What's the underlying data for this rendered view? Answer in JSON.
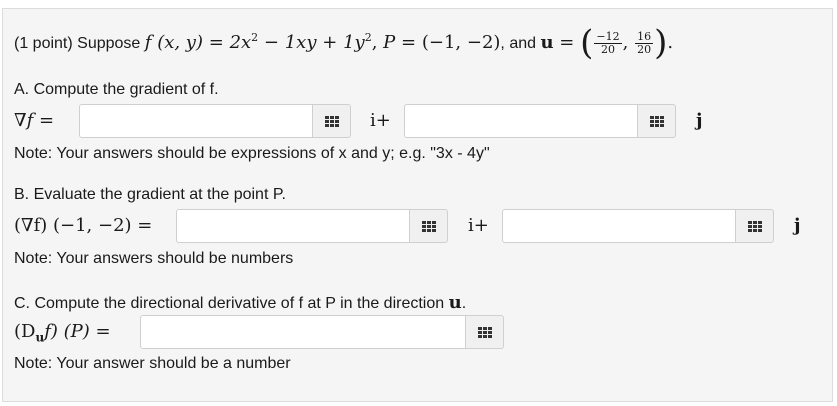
{
  "problem": {
    "points": "(1 point)",
    "intro": "Suppose",
    "function_name": "f",
    "function_args": "(x, y)",
    "equals": "=",
    "term1": "2x",
    "term1_exp": "2",
    "minus": "−",
    "term2": "1xy",
    "plus": "+",
    "term3": "1y",
    "term3_exp": "2",
    "comma": ",",
    "point_label": "P",
    "point_value": "(−1, −2)",
    "and": ", and",
    "vector_label": "u",
    "frac1_num": "−12",
    "frac1_den": "20",
    "frac2_num": "16",
    "frac2_den": "20",
    "period": "."
  },
  "part_a": {
    "prompt": "A. Compute the gradient of f.",
    "lhs": "∇f =",
    "i_label": "i+",
    "j_label": "j",
    "note": "Note: Your answers should be expressions of x and y; e.g. \"3x - 4y\"",
    "input_i_value": "",
    "input_j_value": ""
  },
  "part_b": {
    "prompt": "B. Evaluate the gradient at the point P.",
    "lhs": "(∇f) (−1, −2) =",
    "i_label": "i+",
    "j_label": "j",
    "note": "Note: Your answers should be numbers",
    "input_i_value": "",
    "input_j_value": ""
  },
  "part_c": {
    "prompt_prefix": "C. Compute the directional derivative of f at P in the direction",
    "prompt_vector": "u",
    "prompt_suffix": ".",
    "lhs_open": "(D",
    "lhs_sub": "u",
    "lhs_rest": "f) (P) =",
    "note": "Note: Your answer should be a number",
    "input_value": ""
  },
  "icons": {
    "keyboard": "equation-editor-icon"
  }
}
